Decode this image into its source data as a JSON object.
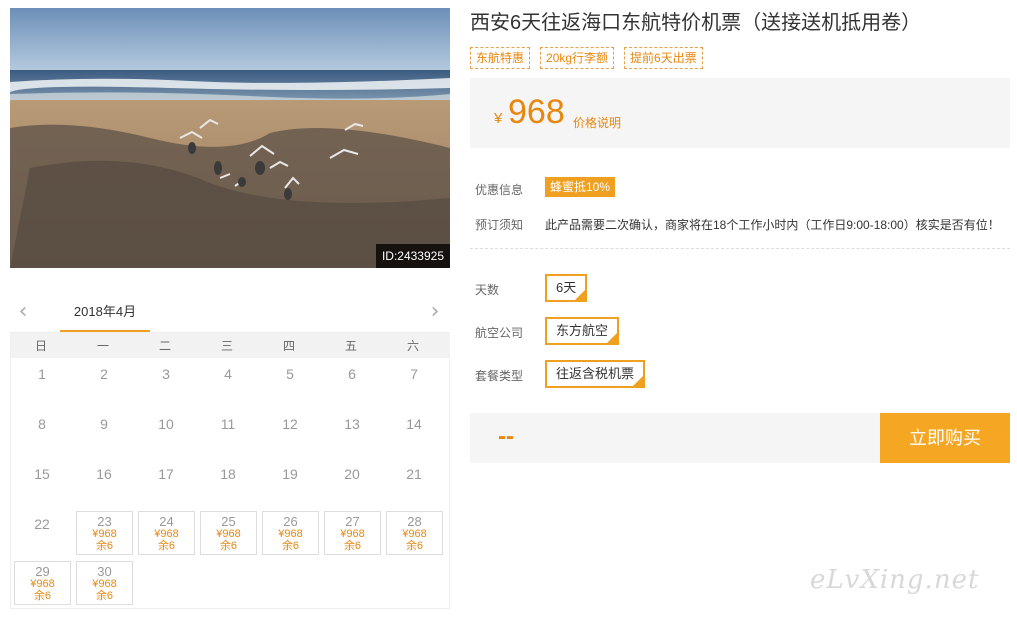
{
  "photo": {
    "id_label": "ID:2433925"
  },
  "calendar": {
    "month": "2018年4月",
    "prev_icon": "chevron-left-icon",
    "next_icon": "chevron-right-icon",
    "weekdays": [
      "日",
      "一",
      "二",
      "三",
      "四",
      "五",
      "六"
    ],
    "days": [
      {
        "d": "1"
      },
      {
        "d": "2"
      },
      {
        "d": "3"
      },
      {
        "d": "4"
      },
      {
        "d": "5"
      },
      {
        "d": "6"
      },
      {
        "d": "7"
      },
      {
        "d": "8"
      },
      {
        "d": "9"
      },
      {
        "d": "10"
      },
      {
        "d": "11"
      },
      {
        "d": "12"
      },
      {
        "d": "13"
      },
      {
        "d": "14"
      },
      {
        "d": "15"
      },
      {
        "d": "16"
      },
      {
        "d": "17"
      },
      {
        "d": "18"
      },
      {
        "d": "19"
      },
      {
        "d": "20"
      },
      {
        "d": "21"
      },
      {
        "d": "22"
      },
      {
        "d": "23",
        "price": "¥968",
        "remain": "余6"
      },
      {
        "d": "24",
        "price": "¥968",
        "remain": "余6"
      },
      {
        "d": "25",
        "price": "¥968",
        "remain": "余6"
      },
      {
        "d": "26",
        "price": "¥968",
        "remain": "余6"
      },
      {
        "d": "27",
        "price": "¥968",
        "remain": "余6"
      },
      {
        "d": "28",
        "price": "¥968",
        "remain": "余6"
      },
      {
        "d": "29",
        "price": "¥968",
        "remain": "余6"
      },
      {
        "d": "30",
        "price": "¥968",
        "remain": "余6"
      }
    ]
  },
  "product": {
    "title": "西安6天往返海口东航特价机票（送接送机抵用卷）",
    "tags": [
      "东航特惠",
      "20kg行李额",
      "提前6天出票"
    ]
  },
  "price": {
    "currency": "¥",
    "amount": "968",
    "explain_link": "价格说明"
  },
  "info": {
    "discount_label": "优惠信息",
    "discount_badge": "蜂蜜抵10%",
    "notice_label": "预订须知",
    "notice_text": "此产品需要二次确认，商家将在18个工作小时内（工作日9:00-18:00）核实是否有位！"
  },
  "options": {
    "days_label": "天数",
    "days_value": "6天",
    "airline_label": "航空公司",
    "airline_value": "东方航空",
    "package_label": "套餐类型",
    "package_value": "往返含税机票"
  },
  "buy": {
    "total": "--",
    "button": "立即购买"
  },
  "watermark": "eLvXing.net",
  "colors": {
    "accent": "#f0a020",
    "price": "#e8870e",
    "buy_button": "#f5a623"
  }
}
